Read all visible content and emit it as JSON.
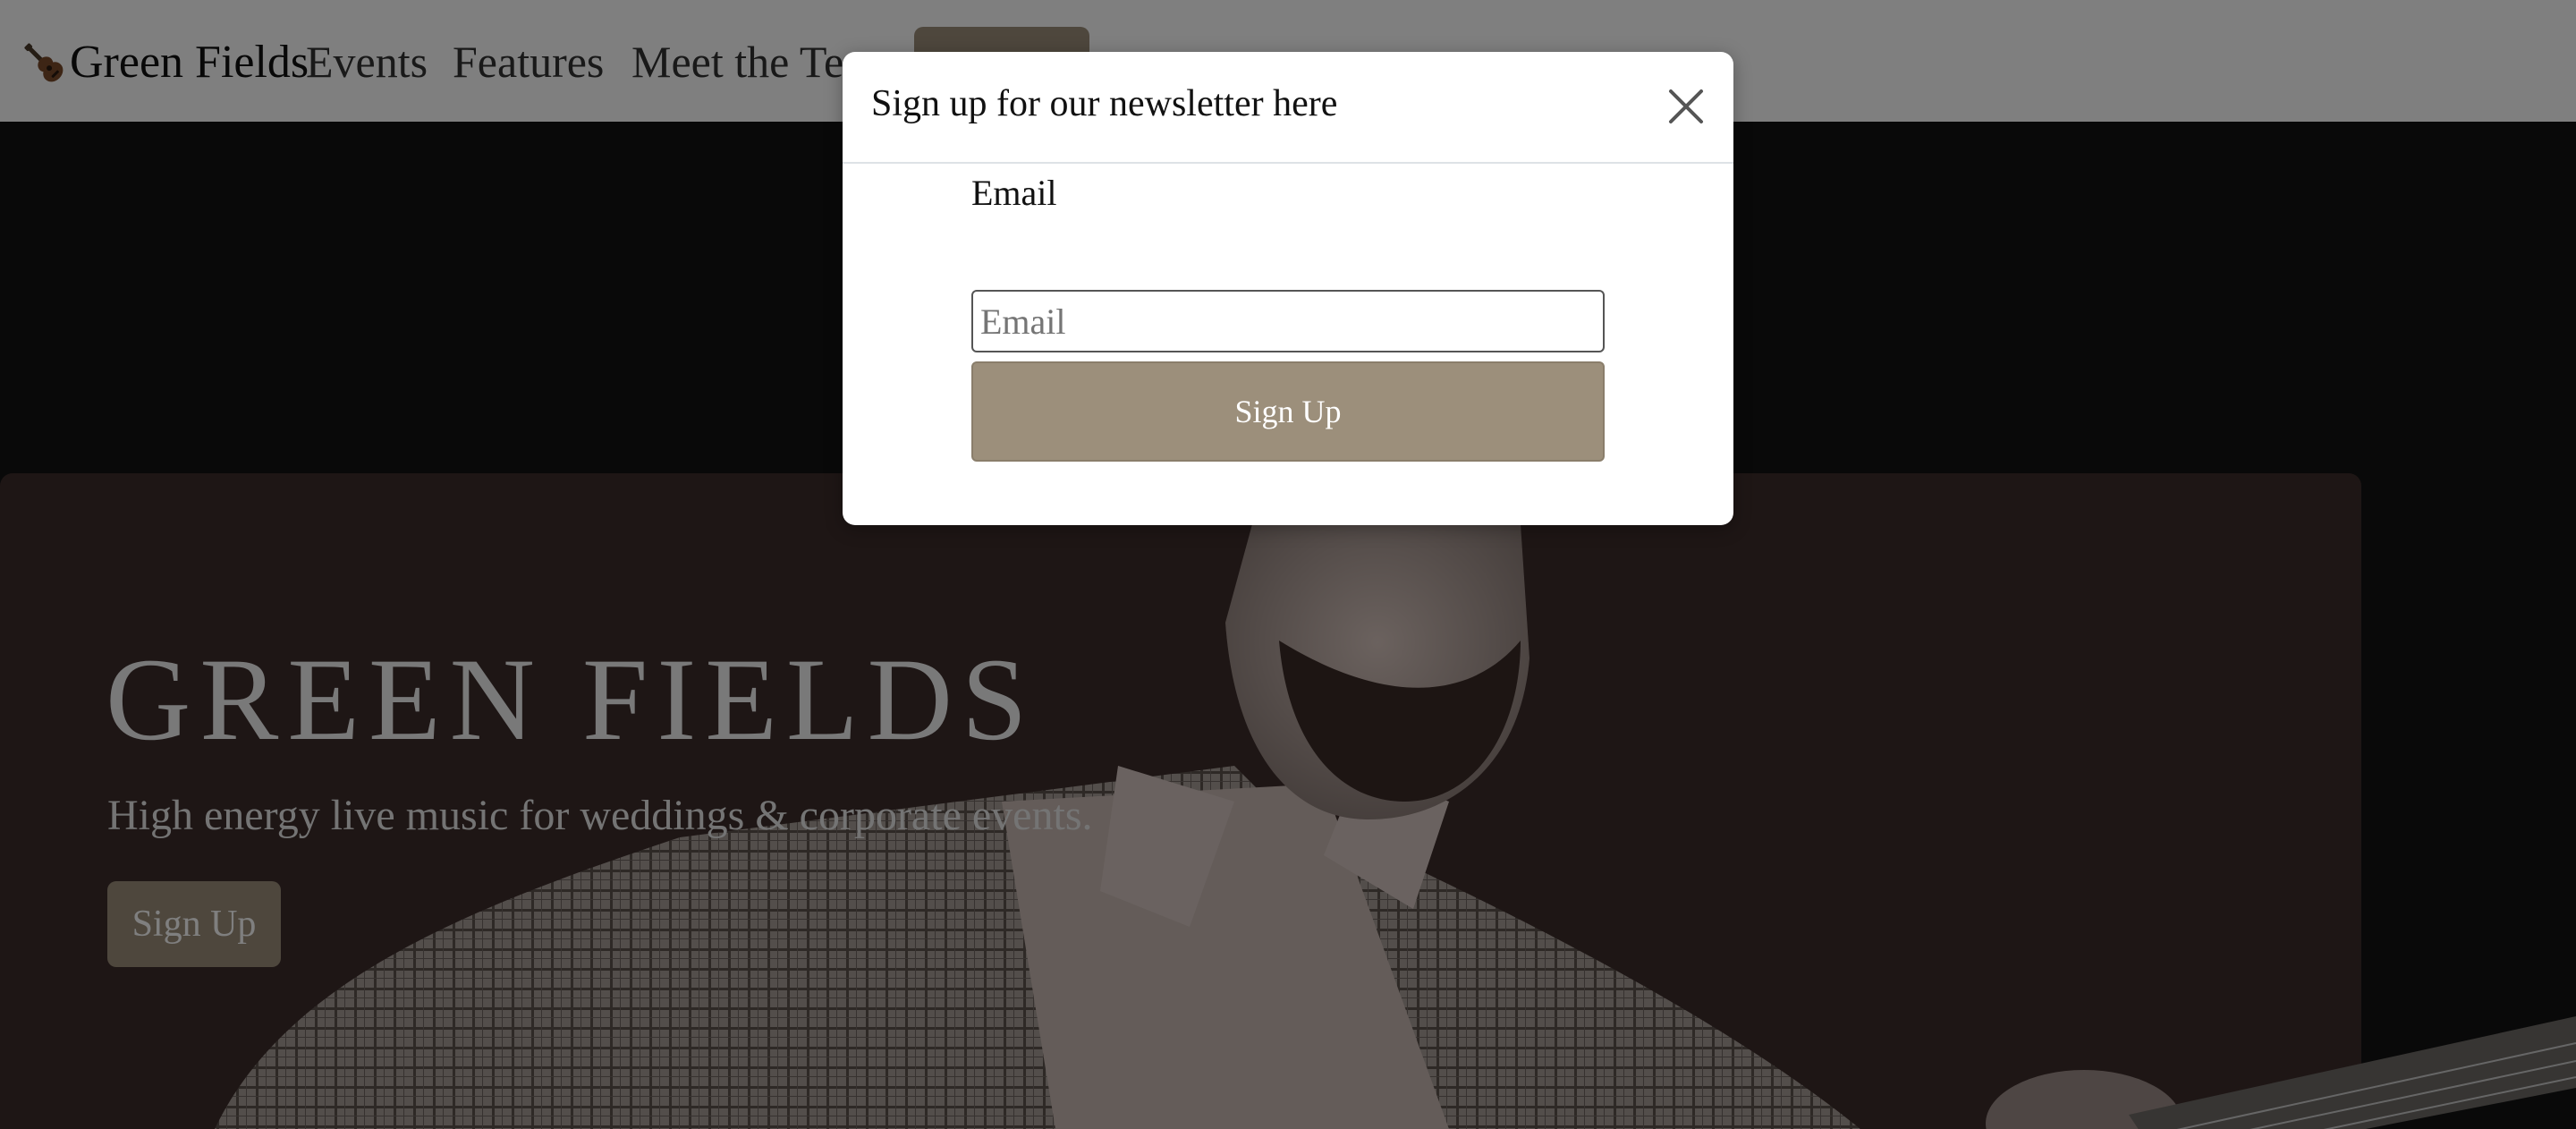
{
  "colors": {
    "accent": "#9c8f7b",
    "navbar_bg": "#ffffff",
    "hero_bg": "#121212",
    "hero_panel": "#3d2c2a",
    "backdrop": "rgba(0,0,0,0.5)"
  },
  "navbar": {
    "brand_icon": "guitar-icon",
    "brand": "Green Fields",
    "links": [
      "Events",
      "Features",
      "Meet the Te"
    ]
  },
  "hero": {
    "title": "GREEN FIELDS",
    "subtitle": "High energy live music for weddings & corporate events.",
    "button_label": "Sign Up"
  },
  "modal": {
    "title": "Sign up for our newsletter here",
    "close_icon": "close-icon",
    "email_label": "Email",
    "email_placeholder": "Email",
    "email_value": "",
    "submit_label": "Sign Up"
  }
}
